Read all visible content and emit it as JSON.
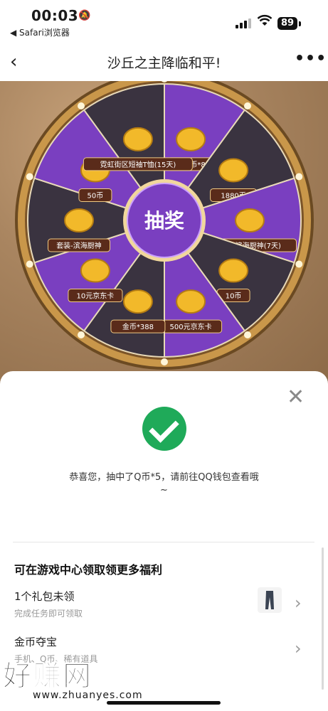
{
  "status_bar": {
    "time": "00:03",
    "back_app": "◀ Safari浏览器",
    "battery": "89"
  },
  "nav": {
    "back_icon": "chevron-left-icon",
    "title": "沙丘之主降临和平!",
    "more_icon": "more-dots-icon"
  },
  "wheel": {
    "center_label": "抽奖",
    "prizes": [
      "服饰币*8",
      "1880币",
      "套装-滨海厨神(7天)",
      "10币",
      "500元京东卡",
      "金币*388",
      "10元京东卡",
      "套装-滨海厨神",
      "50币",
      "霓虹街区短袖T恤(15天)"
    ],
    "colors": {
      "purple": "#7a3fc0",
      "dark": "#3a3340",
      "gold": "#c9974a"
    }
  },
  "result": {
    "close_icon": "close-icon",
    "message_line1": "恭喜您，抽中了Q币*5，请前往QQ钱包查看哦",
    "message_line2": "~"
  },
  "more": {
    "section_title": "可在游戏中心领取领更多福利",
    "rows": [
      {
        "title": "1个礼包未领",
        "subtitle": "完成任务即可领取"
      },
      {
        "title": "金币夺宝",
        "subtitle": "手机、Q币、稀有道具"
      }
    ]
  },
  "watermark": {
    "big": "好赚网",
    "small": "www.zhuanyes.com"
  }
}
